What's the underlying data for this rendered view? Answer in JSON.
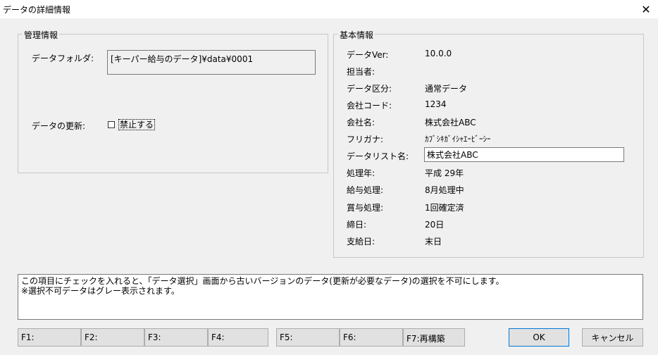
{
  "window": {
    "title": "データの詳細情報",
    "close_glyph": "✕"
  },
  "management": {
    "group_title": "管理情報",
    "folder_label": "データフォルダ:",
    "folder_value": "[キーパー給与のデータ]¥data¥0001",
    "update_label": "データの更新:",
    "prohibit_label": "禁止する",
    "prohibit_checked": false
  },
  "basic": {
    "group_title": "基本情報",
    "rows": [
      {
        "label": "データVer:",
        "value": "10.0.0"
      },
      {
        "label": "担当者:",
        "value": ""
      },
      {
        "label": "データ区分:",
        "value": "通常データ"
      },
      {
        "label": "会社コード:",
        "value": "1234"
      },
      {
        "label": "会社名:",
        "value": "株式会社ABC"
      },
      {
        "label": "フリガナ:",
        "value": "ｶﾌﾞｼｷｶﾞｲｼｬｴｰﾋﾞｰｼｰ"
      },
      {
        "label": "データリスト名:",
        "value": "株式会社ABC"
      },
      {
        "label": "処理年:",
        "value": "平成 29年"
      },
      {
        "label": "給与処理:",
        "value": "8月処理中"
      },
      {
        "label": "賞与処理:",
        "value": "1回確定済"
      },
      {
        "label": "締日:",
        "value": "20日"
      },
      {
        "label": "支給日:",
        "value": "末日"
      }
    ]
  },
  "info": {
    "line1": "この項目にチェックを入れると、「データ選択」画面から古いバージョンのデータ(更新が必要なデータ)の選択を不可にします。",
    "line2": "※選択不可データはグレー表示されます。"
  },
  "buttons": {
    "f1": "F1:",
    "f2": "F2:",
    "f3": "F3:",
    "f4": "F4:",
    "f5": "F5:",
    "f6": "F6:",
    "f7": "F7:再構築",
    "ok": "OK",
    "cancel": "キャンセル"
  }
}
